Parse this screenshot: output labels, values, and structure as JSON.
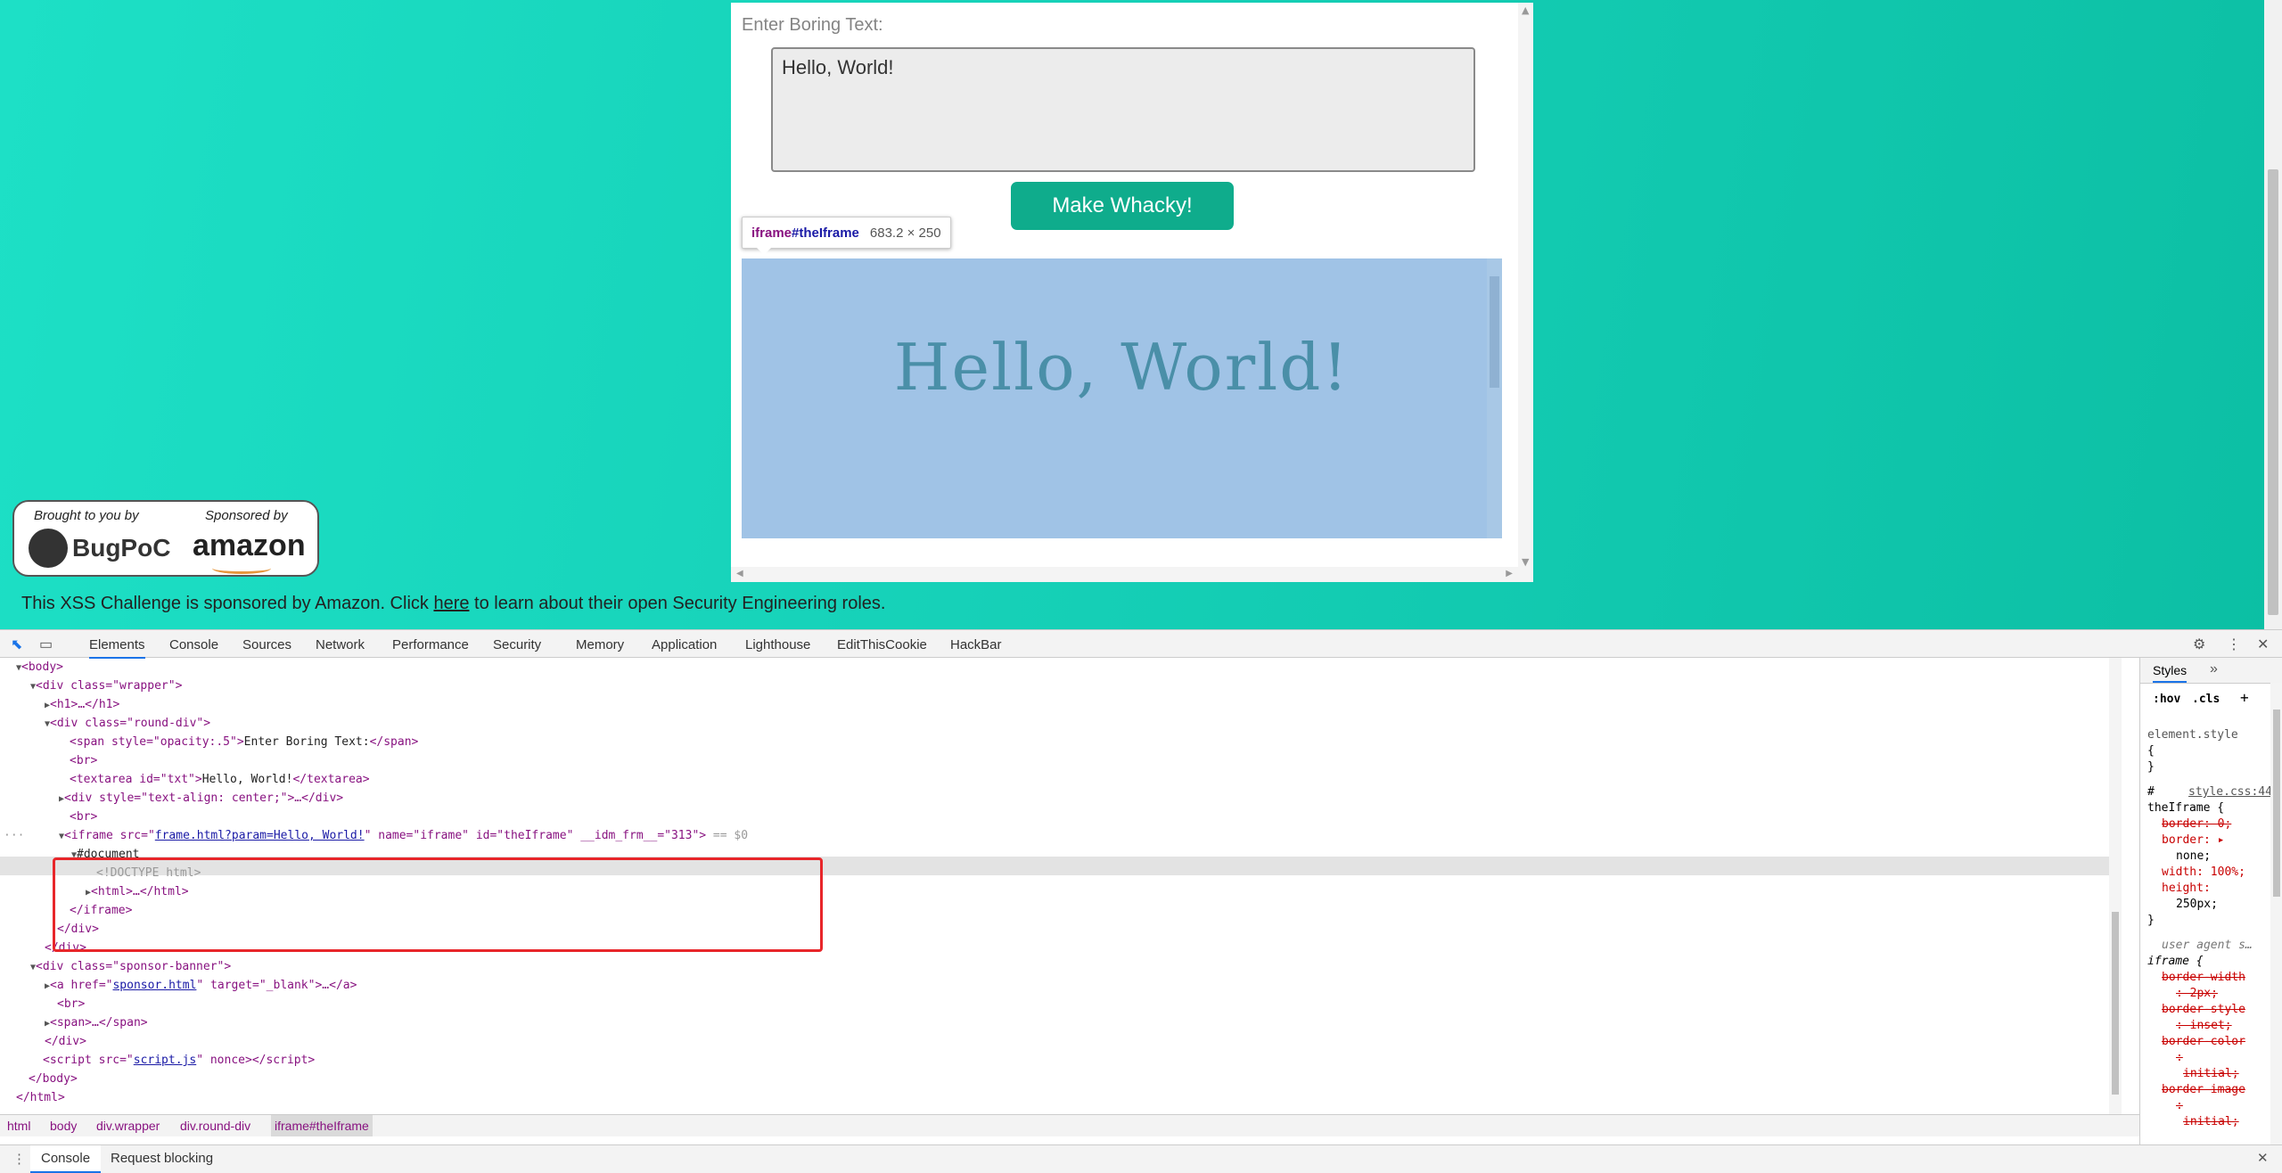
{
  "page": {
    "boring_label": "Enter Boring Text:",
    "textarea_value": "Hello, World!",
    "button_label": "Make Whacky!",
    "tooltip_tag": "iframe",
    "tooltip_id": "#theIframe",
    "tooltip_dims": "683.2 × 250",
    "iframe_text": "Hello, World!",
    "sponsor": {
      "brought_by": "Brought to you by",
      "bugpoc": "BugPoC",
      "sponsored_by": "Sponsored by",
      "amazon": "amazon"
    },
    "xss_before": "This XSS Challenge is sponsored by Amazon. Click ",
    "xss_link": "here",
    "xss_after": " to learn about their open Security Engineering roles."
  },
  "devtools": {
    "tabs": [
      "Elements",
      "Console",
      "Sources",
      "Network",
      "Performance",
      "Security",
      "Memory",
      "Application",
      "Lighthouse",
      "EditThisCookie",
      "HackBar"
    ],
    "dom": {
      "body": "<body>",
      "wrapper_open": "<div class=\"wrapper\">",
      "h1": "<h1>…</h1>",
      "rounddiv_open": "<div class=\"round-div\">",
      "span_a": "<span style=\"opacity:.5\">",
      "span_text": "Enter Boring Text:",
      "span_close": "</span>",
      "br": "<br>",
      "textarea_open": "<textarea id=\"txt\">",
      "textarea_text": "Hello, World!",
      "textarea_close": "</textarea>",
      "div_center": "<div style=\"text-align: center;\">…</div>",
      "iframe_open": "<iframe src=\"",
      "iframe_src": "frame.html?param=Hello, World!",
      "iframe_rest": "\" name=\"iframe\" id=\"theIframe\" __idm_frm__=\"313\">",
      "iframe_eq": " == $0",
      "document": "#document",
      "doctype": "<!DOCTYPE html>",
      "html_collapsed": "<html>…</html>",
      "iframe_close": "</iframe>",
      "div_close": "</div>",
      "sponsor_open": "<div class=\"sponsor-banner\">",
      "a_open": "<a href=\"",
      "a_href": "sponsor.html",
      "a_rest": "\" target=\"_blank\">…</a>",
      "span_collapsed": "<span>…</span>",
      "script_open": "<script src=\"",
      "script_src": "script.js",
      "script_rest": "\" nonce></script>",
      "body_close": "</body>",
      "html_close": "</html>",
      "dots": "···"
    },
    "breadcrumbs": [
      "html",
      "body",
      "div.wrapper",
      "div.round-div",
      "iframe#theIframe"
    ],
    "drawer": [
      "Console",
      "Request blocking"
    ],
    "styles": {
      "tab": "Styles",
      "more": "»",
      "hov": ":hov",
      "cls": ".cls",
      "plus": "+",
      "element_style": "element.style",
      "open_brace": "{",
      "close_brace": "}",
      "hash": "#",
      "file": "style.css:44",
      "selector": "theIframe {",
      "border0": "border: 0;",
      "border_none": "border: ▸",
      "none": "none;",
      "width": "width: 100%;",
      "height": "height:",
      "height_val": "250px;",
      "ua": "user agent s…",
      "iframe_sel": "iframe {",
      "bw": "border-width",
      "bw_val": ": 2px;",
      "bs": "border-style",
      "bs_val": ": inset;",
      "bc": "border-color",
      "bc_val": ":",
      "bc_val2": "initial;",
      "bi": "border-image",
      "bi_val": ":",
      "bi_val2": "initial;"
    }
  }
}
